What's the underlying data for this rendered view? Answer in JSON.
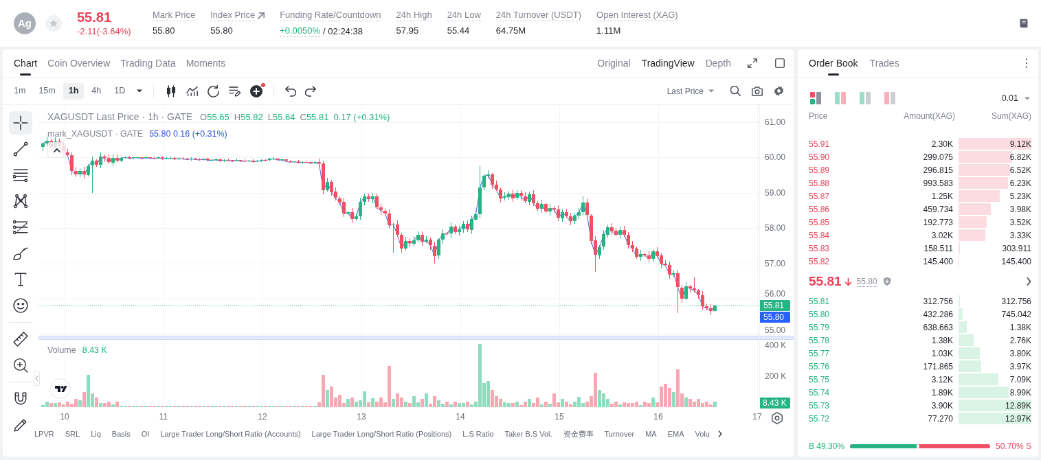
{
  "header": {
    "coin_logo": "Ag",
    "favorited": false,
    "last_price": "55.81",
    "change": "-2.11(-3.64%)",
    "falling": true,
    "stats": [
      {
        "kind": "plain",
        "label": "Mark Price",
        "value": "55.80"
      },
      {
        "kind": "link",
        "label": "Index Price",
        "value": "55.80"
      },
      {
        "kind": "funding",
        "label": "Funding Rate/Countdown",
        "value": "+0.0050%",
        "countdown": "/ 02:24:38"
      },
      {
        "kind": "plain",
        "label": "24h High",
        "value": "57.95"
      },
      {
        "kind": "plain",
        "label": "24h Low",
        "value": "55.44"
      },
      {
        "kind": "plain",
        "label": "24h Turnover (USDT)",
        "value": "64.75M"
      },
      {
        "kind": "plain",
        "label": "Open Interest (XAG)",
        "value": "1.11M"
      }
    ]
  },
  "chart_panel": {
    "tabs": [
      {
        "label": "Chart",
        "selected": true
      },
      {
        "label": "Coin Overview",
        "selected": false
      },
      {
        "label": "Trading Data",
        "selected": false
      },
      {
        "label": "Moments",
        "selected": false
      }
    ],
    "views": [
      {
        "label": "Original",
        "selected": false
      },
      {
        "label": "TradingView",
        "selected": true
      },
      {
        "label": "Depth",
        "selected": false
      }
    ],
    "intervals": [
      {
        "label": "1m",
        "selected": false
      },
      {
        "label": "15m",
        "selected": false
      },
      {
        "label": "1h",
        "selected": true
      },
      {
        "label": "4h",
        "selected": false
      },
      {
        "label": "1D",
        "selected": false
      }
    ],
    "indicator_badge": true,
    "price_source": "Last Price",
    "tool_groups": [
      [
        {
          "kind": "crosshair",
          "selected": true
        },
        {
          "kind": "line",
          "selected": false
        },
        {
          "kind": "parallel",
          "selected": false
        },
        {
          "kind": "pattern",
          "selected": false
        },
        {
          "kind": "fib",
          "selected": false
        },
        {
          "kind": "brush",
          "selected": false
        },
        {
          "kind": "text",
          "selected": false
        },
        {
          "kind": "emoji",
          "selected": false
        }
      ],
      [
        {
          "kind": "ruler",
          "selected": false
        },
        {
          "kind": "zoom",
          "selected": false
        }
      ],
      [
        {
          "kind": "magnet",
          "selected": false
        },
        {
          "kind": "pencil",
          "selected": false
        }
      ]
    ],
    "legend": {
      "title": "XAGUSDT Last Price · 1h · GATE",
      "ohlc": [
        {
          "label": "O",
          "value": "55.65"
        },
        {
          "label": "H",
          "value": "55.82"
        },
        {
          "label": "L",
          "value": "55.64"
        },
        {
          "label": "C",
          "value": "55.81"
        }
      ],
      "change": "0.17 (+0.31%)",
      "mark_title": "mark_XAGUSDT · GATE",
      "mark_values": "55.80 0.16 (+0.31%)"
    },
    "price_axis": [
      "61.00",
      "60.00",
      "59.00",
      "58.00",
      "57.00",
      "56.00",
      "55.00"
    ],
    "last_price_label": "55.81",
    "mark_price_label": "55.80",
    "volume": {
      "title": "Volume",
      "value": "8.43 K",
      "axis": [
        "400 K",
        "200 K"
      ],
      "last_label": "8.43 K"
    },
    "time_axis": [
      "10",
      "11",
      "12",
      "13",
      "14",
      "15",
      "16",
      "17"
    ],
    "indicators": [
      "LPVR",
      "SRL",
      "Liq",
      "Basis",
      "OI",
      "Large Trader Long/Short Ratio (Accounts)",
      "Large Trader Long/Short Ratio (Positions)",
      "L.S Ratio",
      "Taker B.S Vol.",
      "资金费率",
      "Turnover",
      "MA",
      "EMA",
      "Volu"
    ]
  },
  "order_book": {
    "tabs": [
      {
        "label": "Order Book",
        "selected": true
      },
      {
        "label": "Trades",
        "selected": false
      }
    ],
    "layouts": [
      {
        "kind": "both",
        "selected": true
      },
      {
        "kind": "split",
        "selected": false
      },
      {
        "kind": "bids",
        "selected": false
      },
      {
        "kind": "asks",
        "selected": false
      }
    ],
    "precision": "0.01",
    "columns": [
      "Price",
      "Amount(XAG)",
      "Sum(XAG)"
    ],
    "asks": [
      {
        "price": "55.91",
        "amount": "2.30K",
        "sum": "9.12K",
        "level": 1.0
      },
      {
        "price": "55.90",
        "amount": "299.075",
        "sum": "6.82K",
        "level": 0.74
      },
      {
        "price": "55.89",
        "amount": "296.815",
        "sum": "6.52K",
        "level": 0.71
      },
      {
        "price": "55.88",
        "amount": "993.583",
        "sum": "6.23K",
        "level": 0.68
      },
      {
        "price": "55.87",
        "amount": "1.25K",
        "sum": "5.23K",
        "level": 0.57
      },
      {
        "price": "55.86",
        "amount": "459.734",
        "sum": "3.98K",
        "level": 0.44
      },
      {
        "price": "55.85",
        "amount": "192.773",
        "sum": "3.52K",
        "level": 0.39
      },
      {
        "price": "55.84",
        "amount": "3.02K",
        "sum": "3.33K",
        "level": 0.37
      },
      {
        "price": "55.83",
        "amount": "158.511",
        "sum": "303.911",
        "level": 0.02
      },
      {
        "price": "55.82",
        "amount": "145.400",
        "sum": "145.400",
        "level": 0.01
      }
    ],
    "last_price": "55.81",
    "mark_price": "55.80",
    "bids": [
      {
        "price": "55.81",
        "amount": "312.756",
        "sum": "312.756",
        "level": 0.02
      },
      {
        "price": "55.80",
        "amount": "432.286",
        "sum": "745.042",
        "level": 0.06
      },
      {
        "price": "55.79",
        "amount": "638.663",
        "sum": "1.38K",
        "level": 0.11
      },
      {
        "price": "55.78",
        "amount": "1.38K",
        "sum": "2.76K",
        "level": 0.21
      },
      {
        "price": "55.77",
        "amount": "1.03K",
        "sum": "3.80K",
        "level": 0.29
      },
      {
        "price": "55.76",
        "amount": "171.865",
        "sum": "3.97K",
        "level": 0.31
      },
      {
        "price": "55.75",
        "amount": "3.12K",
        "sum": "7.09K",
        "level": 0.55
      },
      {
        "price": "55.74",
        "amount": "1.89K",
        "sum": "8.99K",
        "level": 0.69
      },
      {
        "price": "55.73",
        "amount": "3.90K",
        "sum": "12.89K",
        "level": 0.99
      },
      {
        "price": "55.72",
        "amount": "77.270",
        "sum": "12.97K",
        "level": 1.0
      }
    ],
    "ratio": {
      "buy": "B 49.30%",
      "sell": "50.70% S",
      "level": 0.493
    }
  }
}
